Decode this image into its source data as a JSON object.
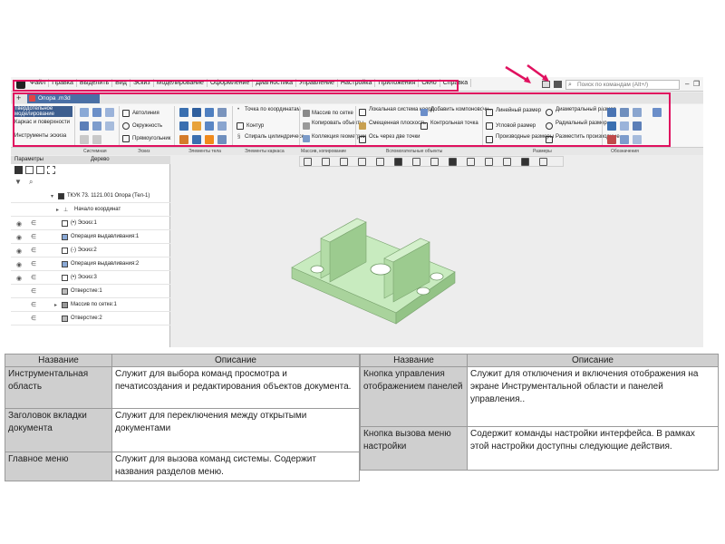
{
  "menubar": {
    "items": [
      "Файл",
      "Правка",
      "Выделить",
      "Вид",
      "Эскиз",
      "Моделирование",
      "Оформление",
      "Диагностика",
      "Управление",
      "Настройка",
      "Приложения",
      "Окно",
      "Справка"
    ],
    "search_placeholder": "Поиск по командам (Alt+/)"
  },
  "document_tab": {
    "label": "Опора .m3d"
  },
  "ribbon": {
    "categories": [
      "Твердотельное моделирование",
      "Каркас и поверхности",
      "Инструменты эскиза"
    ],
    "commands": {
      "sketch": [
        "Автолиния",
        "Окружность",
        "Прямоугольник"
      ],
      "wireframe": [
        "Точка по координатам",
        "Контур",
        "Спираль цилиндрическ..."
      ],
      "array": [
        "Массив по сетке",
        "Копировать объекты",
        "Коллекция геометрии"
      ],
      "auxiliary": [
        "Локальная система коорд...",
        "Смещенная плоскость",
        "Ось через две точки",
        "Добавить компоновочн...",
        "Контрольная точка"
      ],
      "dimensions": [
        "Линейный размер",
        "Угловой размер",
        "Производные размеры",
        "Диаметральный размер",
        "Радиальный размер",
        "Разместить производные..."
      ]
    },
    "group_labels": [
      "Системная",
      "Эскиз",
      "Элементы тела",
      "Элементы каркаса",
      "Массив, копирование",
      "Вспомогательные объекты",
      "Размеры",
      "Обозначения"
    ]
  },
  "tree": {
    "tabs": [
      "Параметры",
      "Дерево"
    ],
    "items": [
      "ТКУК 73. 1121.001 Опора  (Тел-1)",
      "Начало координат",
      "(•) Эскиз:1",
      "Операция выдавливания:1",
      "(-) Эскиз:2",
      "Операция выдавливания:2",
      "(•) Эскиз:3",
      "Отверстие:1",
      "Массив по сетке:1",
      "Отверстие:2"
    ]
  },
  "table_left": {
    "headers": [
      "Название",
      "Описание"
    ],
    "rows": [
      {
        "name": "Инструментальная область",
        "desc": "Служит для выбора команд просмотра и печатисоздания и редактирования объектов документа."
      },
      {
        "name": "Заголовок вкладки документа",
        "desc": "Служит для переключения между открытыми документами"
      },
      {
        "name": "Главное меню",
        "desc": "Служит для вызова команд системы. Содержит названия разделов меню."
      }
    ]
  },
  "table_right": {
    "headers": [
      "Название",
      "Описание"
    ],
    "rows": [
      {
        "name": "Кнопка управления отображением панелей",
        "desc": "Служит для отключения и включения отображения на экране Инструментальной области и панелей управления.."
      },
      {
        "name": "Кнопка вызова меню настройки",
        "desc": "Содержит команды настройки интерфейса. В рамках этой настройки доступны следующие действия."
      }
    ]
  },
  "colors": {
    "highlight": "#e0115f",
    "model_fill": "#bfe3b4",
    "header_gray": "#cfcfcf"
  }
}
